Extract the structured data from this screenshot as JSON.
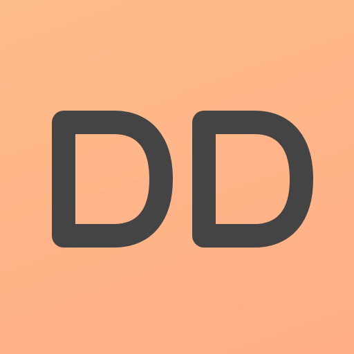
{
  "avatar": {
    "initials": "DD",
    "background_color_start": "#FFBC8C",
    "background_color_end": "#FFAE86",
    "text_color": "#444444"
  }
}
